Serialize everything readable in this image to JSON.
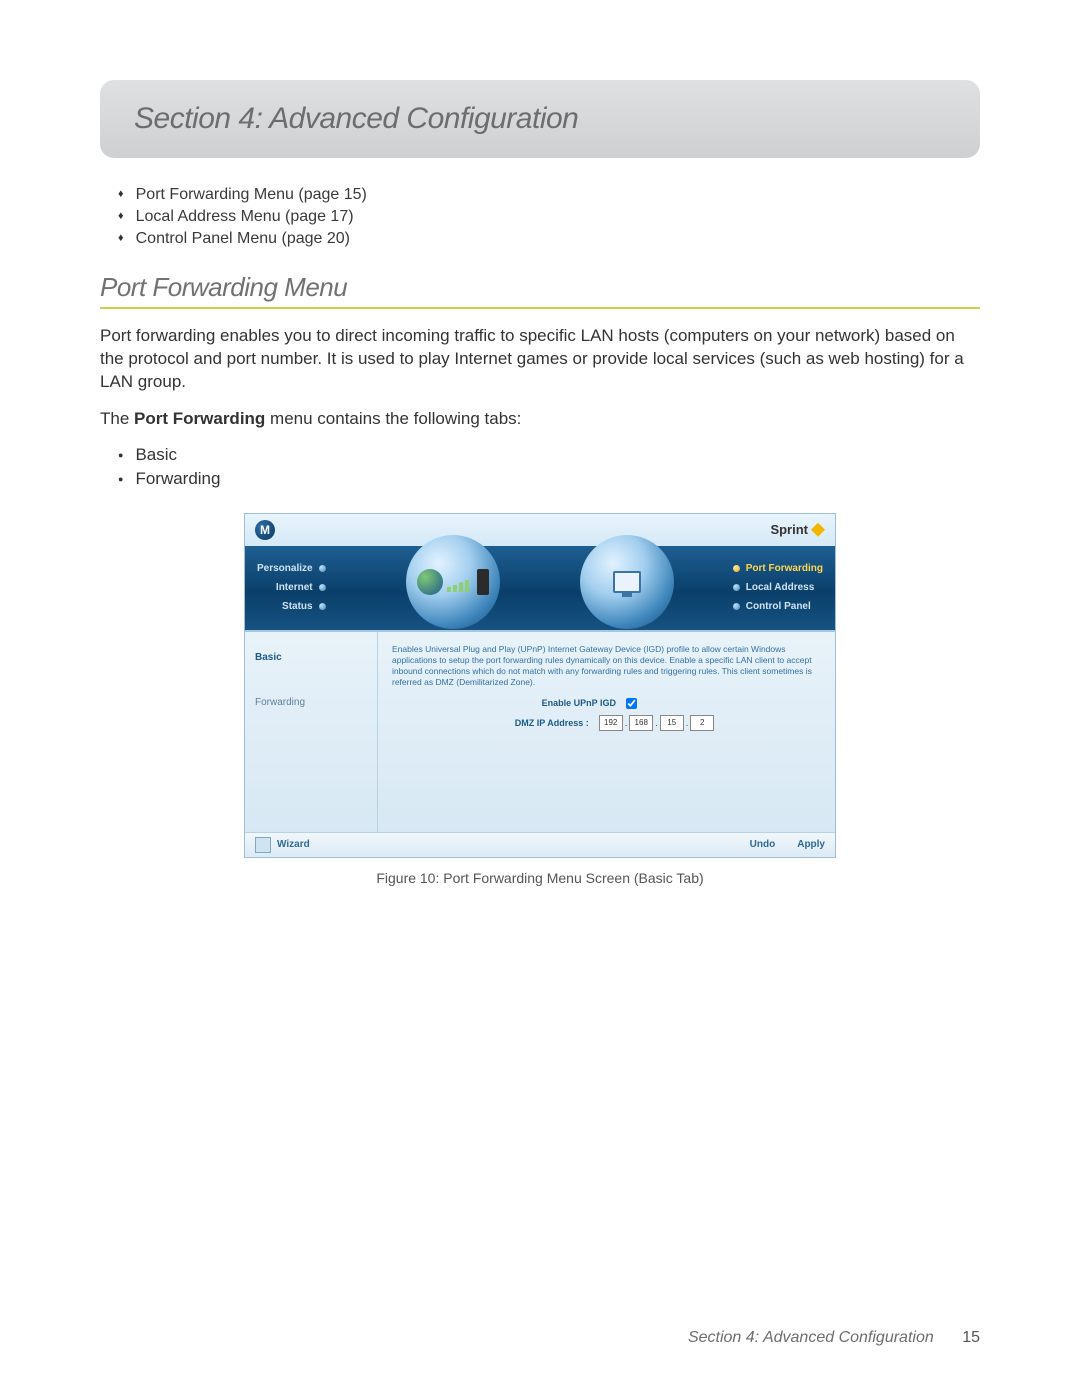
{
  "header": {
    "title": "Section 4: Advanced Configuration"
  },
  "toc": [
    "Port Forwarding Menu (page 15)",
    "Local Address Menu (page 17)",
    "Control Panel Menu (page 20)"
  ],
  "section": {
    "title": "Port Forwarding Menu",
    "para1": "Port forwarding enables you to direct incoming traffic to specific LAN hosts (computers on your network) based on the protocol and port number. It is used to play Internet games or provide local services (such as web hosting) for a LAN group.",
    "para2_pre": "The ",
    "para2_bold": "Port Forwarding",
    "para2_post": " menu contains the following tabs:",
    "tabs": [
      "Basic",
      "Forwarding"
    ]
  },
  "app": {
    "brand_left": "M",
    "brand_right": "Sprint",
    "nav_left": [
      "Personalize",
      "Internet",
      "Status"
    ],
    "nav_right": [
      {
        "label": "Port Forwarding",
        "active": true
      },
      {
        "label": "Local Address",
        "active": false
      },
      {
        "label": "Control Panel",
        "active": false
      }
    ],
    "side_tabs": [
      {
        "label": "Basic",
        "active": true
      },
      {
        "label": "Forwarding",
        "active": false
      }
    ],
    "description": "Enables Universal Plug and Play (UPnP) Internet Gateway Device (IGD) profile to allow certain Windows applications to setup the port forwarding rules dynamically on this device. Enable a specific LAN client to accept inbound connections which do not match with any forwarding rules and triggering rules. This client sometimes is referred as DMZ (Demilitarized Zone).",
    "form": {
      "upnp_label": "Enable UPnP IGD",
      "upnp_checked": true,
      "dmz_label": "DMZ IP Address :",
      "dmz_ip": [
        "192",
        "168",
        "15",
        "2"
      ]
    },
    "footer": {
      "wizard": "Wizard",
      "undo": "Undo",
      "apply": "Apply"
    }
  },
  "caption": "Figure 10: Port Forwarding Menu Screen (Basic Tab)",
  "footer": {
    "text": "Section 4: Advanced Configuration",
    "page": "15"
  }
}
